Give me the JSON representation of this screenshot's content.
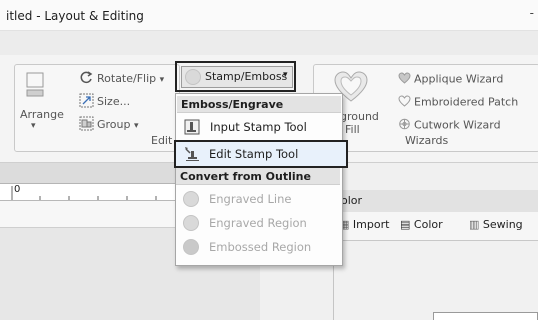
{
  "window": {
    "title": "itled - Layout & Editing",
    "minimize_glyph": "-"
  },
  "ribbon": {
    "arrange_label": "Arrange",
    "rotate_flip_label": "Rotate/Flip",
    "size_label": "Size...",
    "group_label": "Group",
    "edit_group_label": "Edit",
    "stamp_emboss_label": "Stamp/Emboss",
    "background_label_1": "ground",
    "background_label_2": "Fill",
    "applique_wizard_label": "Applique Wizard",
    "embroidered_patch_label": "Embroidered Patch",
    "cutwork_wizard_label": "Cutwork Wizard",
    "wizards_group_label": "Wizards"
  },
  "menu": {
    "header_emboss": "Emboss/Engrave",
    "items_emboss": [
      {
        "label": "Input Stamp Tool",
        "icon": "input-stamp-icon",
        "enabled": true
      },
      {
        "label": "Edit Stamp Tool",
        "icon": "edit-stamp-icon",
        "enabled": true,
        "highlighted": true
      }
    ],
    "header_convert": "Convert from Outline",
    "items_convert": [
      {
        "label": "Engraved Line",
        "icon": "engraved-line-icon",
        "enabled": false
      },
      {
        "label": "Engraved Region",
        "icon": "engraved-region-icon",
        "enabled": false
      },
      {
        "label": "Embossed Region",
        "icon": "embossed-region-icon",
        "enabled": false
      }
    ]
  },
  "ruler": {
    "origin_label": "0"
  },
  "panel": {
    "title": "olor",
    "tabs": [
      {
        "label": "Import",
        "icon": "import-icon"
      },
      {
        "label": "Color",
        "icon": "color-icon"
      },
      {
        "label": "Sewing",
        "icon": "sewing-icon"
      }
    ]
  },
  "colors": {
    "highlight_border": "#222222",
    "menu_header_bg": "#e3e3e3",
    "disabled_text": "#a8a8a8"
  }
}
